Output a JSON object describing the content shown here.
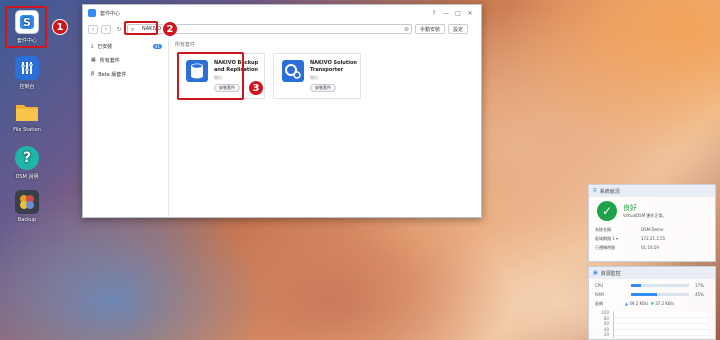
{
  "desktop": {
    "icons": [
      {
        "label": "套件中心",
        "icon": "package-center-icon"
      },
      {
        "label": "控制台",
        "icon": "control-panel-icon"
      },
      {
        "label": "File Station",
        "icon": "folder-icon"
      },
      {
        "label": "DSM 說明",
        "icon": "help-icon"
      },
      {
        "label": "Backup",
        "icon": "backup-icon"
      }
    ]
  },
  "callouts": [
    "1",
    "2",
    "3"
  ],
  "window": {
    "title": "套件中心",
    "controls": [
      "?",
      "—",
      "□",
      "✕"
    ],
    "search_value": "NAKIVO",
    "manual_install": "手動安裝",
    "settings": "設定",
    "sidebar": [
      {
        "label": "已安裝",
        "count": "41",
        "icon": "download-icon"
      },
      {
        "label": "所有套件",
        "icon": "grid-icon"
      },
      {
        "label": "Beta 版套件",
        "icon": "beta-icon"
      }
    ],
    "section_label": "所有套件",
    "cards": [
      {
        "name": "NAKIVO Backup and Replication",
        "category": "備份",
        "button": "安裝套件"
      },
      {
        "name": "NAKIVO Solution Transporter",
        "category": "備份",
        "button": "安裝套件"
      }
    ]
  },
  "health_widget": {
    "title": "系統狀況",
    "status": "良好",
    "status_sub": "VirtualDSM 運作正常。",
    "rows": [
      {
        "k": "系統名稱",
        "v": "DSM-Demo"
      },
      {
        "k": "區域網路 1 ▾",
        "v": "172.21.2.55"
      },
      {
        "k": "已運轉時間",
        "v": "01:16:59"
      }
    ]
  },
  "resource_widget": {
    "title": "資源監控",
    "cpu_label": "CPU",
    "cpu_value": "17%",
    "cpu_pct": 17,
    "ram_label": "RAM",
    "ram_value": "45%",
    "ram_pct": 45,
    "net_label": "區網",
    "net_up": "49.2 KB/s",
    "net_down": "37.2 KB/s",
    "y_ticks": [
      "100",
      "80",
      "60",
      "40",
      "20"
    ]
  }
}
